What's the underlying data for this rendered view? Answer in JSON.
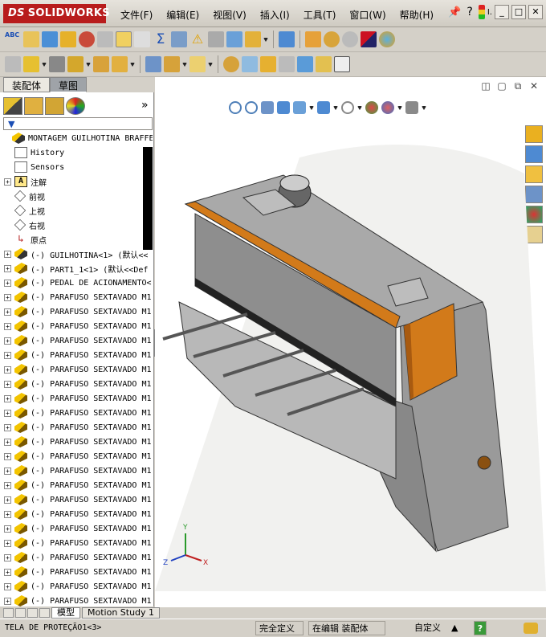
{
  "app": {
    "logo": "SOLIDWORKS",
    "ds": "DS"
  },
  "menu": [
    "文件(F)",
    "编辑(E)",
    "视图(V)",
    "插入(I)",
    "工具(T)",
    "窗口(W)",
    "帮助(H)"
  ],
  "title_controls": {
    "help": "?",
    "minimize": "_",
    "maximize": "□",
    "close": "✕",
    "pin_label": "I."
  },
  "left_tabs": [
    {
      "label": "装配体",
      "active": false
    },
    {
      "label": "草图",
      "active": true
    }
  ],
  "panel": {
    "expand_glyph": "»",
    "filter_glyph": "▼"
  },
  "tree": {
    "root": "MONTAGEM GUILHOTINA BRAFFEMAM",
    "items": [
      {
        "label": "History",
        "icon": "history-icon",
        "expand": false
      },
      {
        "label": "Sensors",
        "icon": "sensors-icon",
        "expand": false
      },
      {
        "label": "注解",
        "icon": "annotations-icon",
        "expand": true
      },
      {
        "label": "前视",
        "icon": "plane-icon",
        "expand": false
      },
      {
        "label": "上视",
        "icon": "plane-icon",
        "expand": false
      },
      {
        "label": "右视",
        "icon": "plane-icon",
        "expand": false
      },
      {
        "label": "原点",
        "icon": "origin-icon",
        "expand": false
      },
      {
        "label": "(-) GUILHOTINA<1> (默认<<",
        "icon": "assembly-icon",
        "expand": true
      },
      {
        "label": "(-) PART1_1<1> (默认<<Def",
        "icon": "part-icon",
        "expand": true
      },
      {
        "label": "(-) PEDAL DE ACIONAMENTO<",
        "icon": "part-icon",
        "expand": true
      },
      {
        "label": "(-) PARAFUSO SEXTAVADO M1",
        "icon": "part-icon",
        "expand": true
      },
      {
        "label": "(-) PARAFUSO SEXTAVADO M1",
        "icon": "part-icon",
        "expand": true
      },
      {
        "label": "(-) PARAFUSO SEXTAVADO M1",
        "icon": "part-icon",
        "expand": true
      },
      {
        "label": "(-) PARAFUSO SEXTAVADO M1",
        "icon": "part-icon",
        "expand": true
      },
      {
        "label": "(-) PARAFUSO SEXTAVADO M1",
        "icon": "part-icon",
        "expand": true
      },
      {
        "label": "(-) PARAFUSO SEXTAVADO M1",
        "icon": "part-icon",
        "expand": true
      },
      {
        "label": "(-) PARAFUSO SEXTAVADO M1",
        "icon": "part-icon",
        "expand": true
      },
      {
        "label": "(-) PARAFUSO SEXTAVADO M1",
        "icon": "part-icon",
        "expand": true
      },
      {
        "label": "(-) PARAFUSO SEXTAVADO M1",
        "icon": "part-icon",
        "expand": true
      },
      {
        "label": "(-) PARAFUSO SEXTAVADO M1",
        "icon": "part-icon",
        "expand": true
      },
      {
        "label": "(-) PARAFUSO SEXTAVADO M1",
        "icon": "part-icon",
        "expand": true
      },
      {
        "label": "(-) PARAFUSO SEXTAVADO M1",
        "icon": "part-icon",
        "expand": true
      },
      {
        "label": "(-) PARAFUSO SEXTAVADO M1",
        "icon": "part-icon",
        "expand": true
      },
      {
        "label": "(-) PARAFUSO SEXTAVADO M1",
        "icon": "part-icon",
        "expand": true
      },
      {
        "label": "(-) PARAFUSO SEXTAVADO M1",
        "icon": "part-icon",
        "expand": true
      },
      {
        "label": "(-) PARAFUSO SEXTAVADO M1",
        "icon": "part-icon",
        "expand": true
      },
      {
        "label": "(-) PARAFUSO SEXTAVADO M1",
        "icon": "part-icon",
        "expand": true
      },
      {
        "label": "(-) PARAFUSO SEXTAVADO M1",
        "icon": "part-icon",
        "expand": true
      },
      {
        "label": "(-) PARAFUSO SEXTAVADO M1",
        "icon": "part-icon",
        "expand": true
      },
      {
        "label": "(-) PARAFUSO SEXTAVADO M1",
        "icon": "part-icon",
        "expand": true
      },
      {
        "label": "(-) PARAFUSO SEXTAVADO M1",
        "icon": "part-icon",
        "expand": true
      },
      {
        "label": "(-) PARAFUSO SEXTAVADO M1",
        "icon": "part-icon",
        "expand": true
      },
      {
        "label": "(-) PARAFUSO SEXTAVADO M1",
        "icon": "part-icon",
        "expand": true
      },
      {
        "label": "(-) PARAFUSO SEXTAVADO M1",
        "icon": "part-icon",
        "expand": true
      }
    ]
  },
  "viewport": {
    "controls": [
      "◫",
      "▢",
      "⧉",
      "✕"
    ]
  },
  "triad": {
    "x": "X",
    "y": "Y",
    "z": "Z"
  },
  "bottom_tabs": [
    {
      "label": "模型",
      "active": true
    },
    {
      "label": "Motion Study 1",
      "active": false
    }
  ],
  "status": {
    "left": "TELA DE PROTEÇÃO1<3>",
    "definition": "完全定义",
    "mode": "在编辑 装配体",
    "units": "自定义",
    "help": "?"
  },
  "colors": {
    "brand": "#b81c1c",
    "machine_body": "#9a9a9a",
    "accent_orange": "#d27a1a"
  }
}
